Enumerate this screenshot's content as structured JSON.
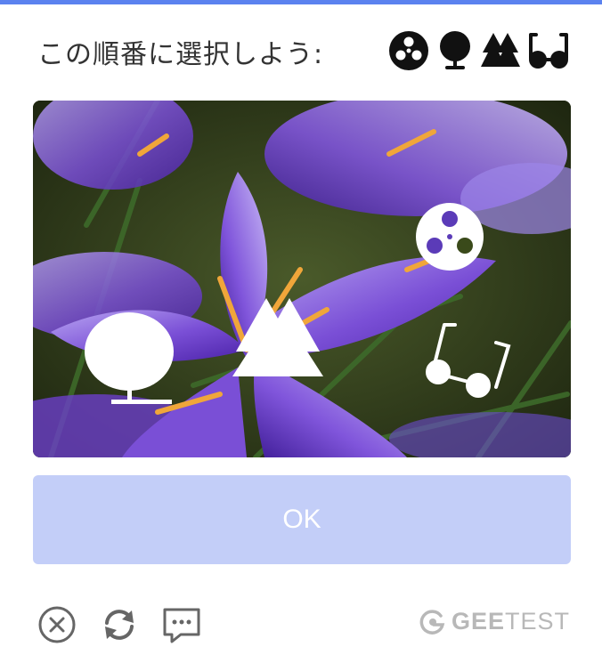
{
  "header": {
    "instruction": "この順番に選択しよう:",
    "accent_color": "#5b82ef",
    "target_icons": [
      "film-reel-icon",
      "tree-icon",
      "pine-trees-icon",
      "glasses-icon"
    ]
  },
  "puzzle": {
    "image": "purple-crocus-flowers",
    "overlay_icons": [
      "film-reel-icon",
      "tree-icon",
      "pine-trees-icon",
      "glasses-icon"
    ]
  },
  "actions": {
    "ok_label": "OK",
    "ok_color": "#c3cef8"
  },
  "footer": {
    "tools": [
      "close-icon",
      "refresh-icon",
      "feedback-icon"
    ],
    "brand_bold": "GEE",
    "brand_light": "TEST"
  }
}
